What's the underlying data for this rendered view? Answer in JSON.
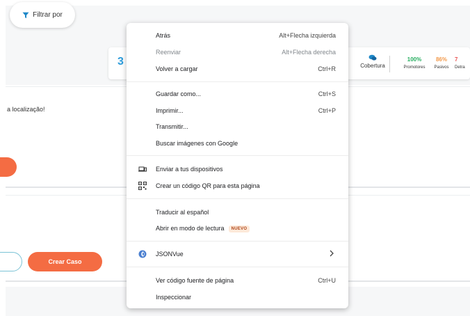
{
  "background": {
    "filter_button": "Filtrar por",
    "stats_big_number": "3",
    "cobertura_label": "Cobertura",
    "metrics": [
      {
        "value": "100%",
        "label": "Promotores",
        "color": "#27ae60"
      },
      {
        "value": "86%",
        "label": "Pasivos",
        "color": "#f2994a"
      },
      {
        "value": "7",
        "label": "Detra",
        "color": "#eb5757"
      }
    ],
    "location_text": "a localização!",
    "create_case_button": "Crear Caso",
    "colors": {
      "primary_orange": "#f46c43",
      "accent_blue": "#2d9cdb"
    }
  },
  "context_menu": {
    "back": {
      "label": "Atrás",
      "shortcut": "Alt+Flecha izquierda"
    },
    "forward": {
      "label": "Reenviar",
      "shortcut": "Alt+Flecha derecha"
    },
    "reload": {
      "label": "Volver a cargar",
      "shortcut": "Ctrl+R"
    },
    "save_as": {
      "label": "Guardar como...",
      "shortcut": "Ctrl+S"
    },
    "print": {
      "label": "Imprimir...",
      "shortcut": "Ctrl+P"
    },
    "cast": {
      "label": "Transmitir..."
    },
    "search_images": {
      "label": "Buscar imágenes con Google"
    },
    "send_devices": {
      "label": "Enviar a tus dispositivos",
      "icon": "devices-icon"
    },
    "qr_code": {
      "label": "Crear un código QR para esta página",
      "icon": "qr-code-icon"
    },
    "translate": {
      "label": "Traducir al español"
    },
    "reading_mode": {
      "label": "Abrir en modo de lectura",
      "badge": "NUEVO"
    },
    "jsonvue": {
      "label": "JSONVue",
      "icon": "jsonvue-icon"
    },
    "view_source": {
      "label": "Ver código fuente de página",
      "shortcut": "Ctrl+U"
    },
    "inspect": {
      "label": "Inspeccionar"
    }
  }
}
